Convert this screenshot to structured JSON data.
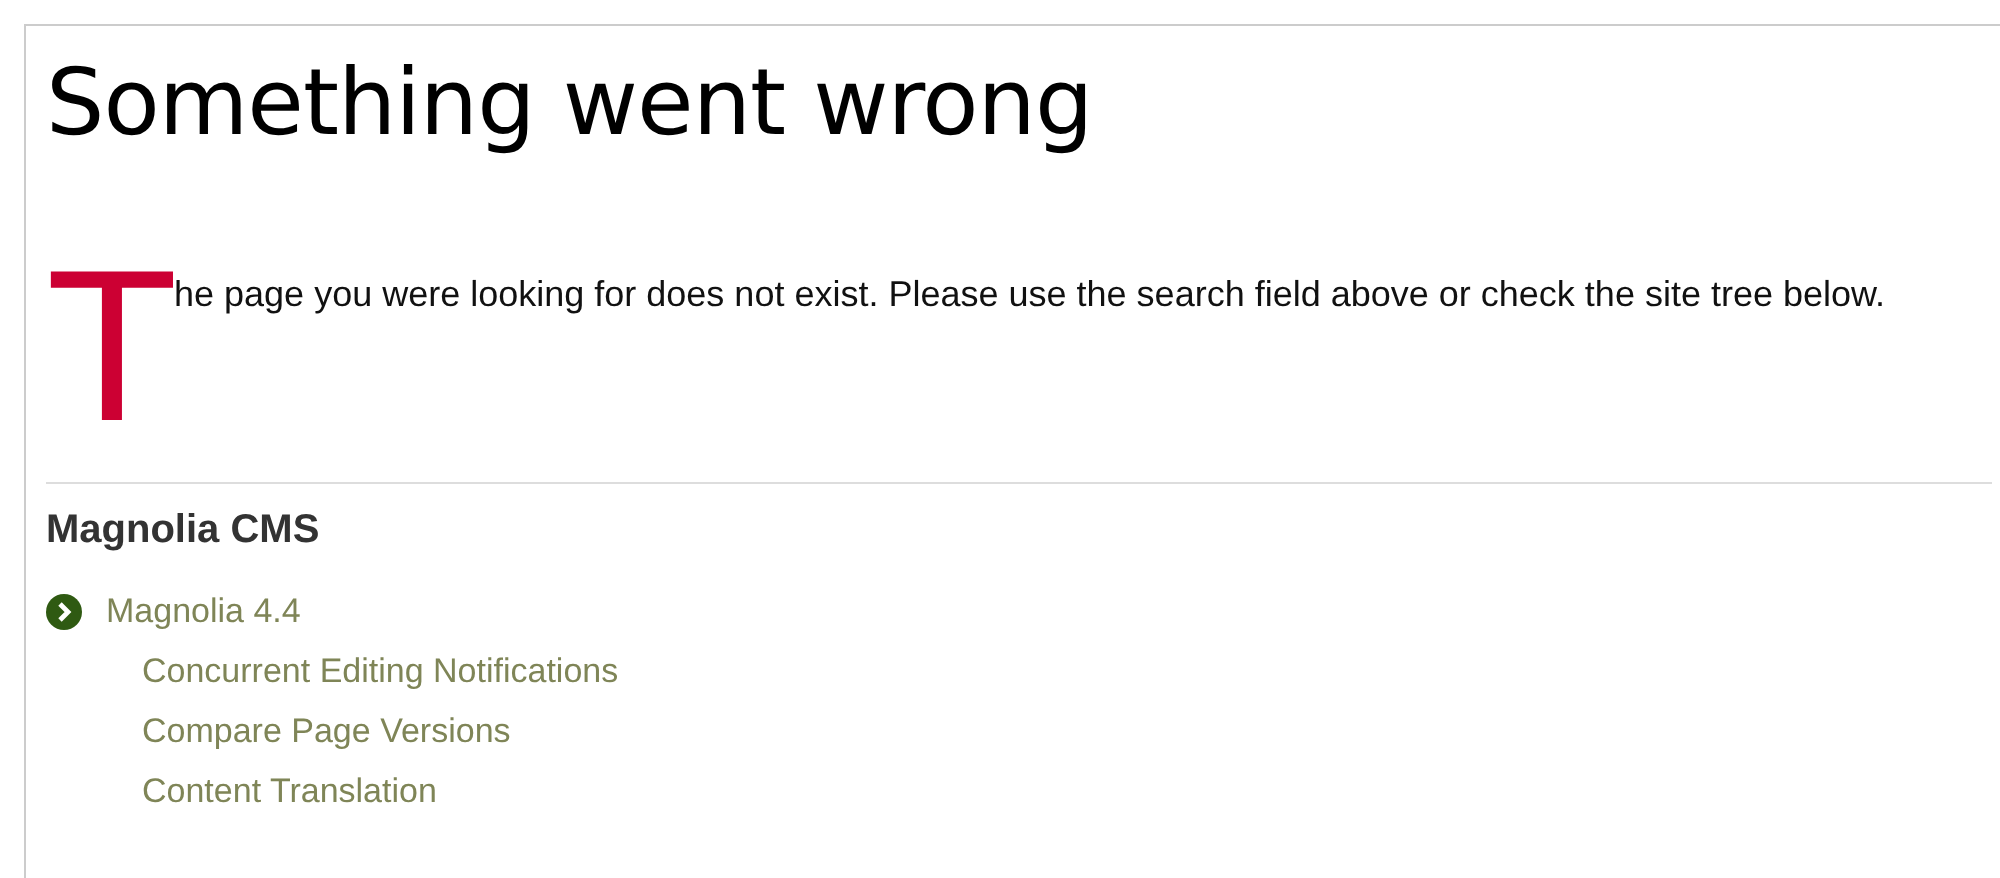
{
  "title": "Something went wrong",
  "message": {
    "drop_cap": "T",
    "text": "he page you were looking for does not exist. Please use the search field above or check the site tree below."
  },
  "site_tree": {
    "heading": "Magnolia CMS",
    "items": [
      {
        "label": "Magnolia 4.4",
        "children": [
          {
            "label": "Concurrent Editing Notifications"
          },
          {
            "label": "Compare Page Versions"
          },
          {
            "label": "Content Translation"
          }
        ]
      }
    ]
  }
}
